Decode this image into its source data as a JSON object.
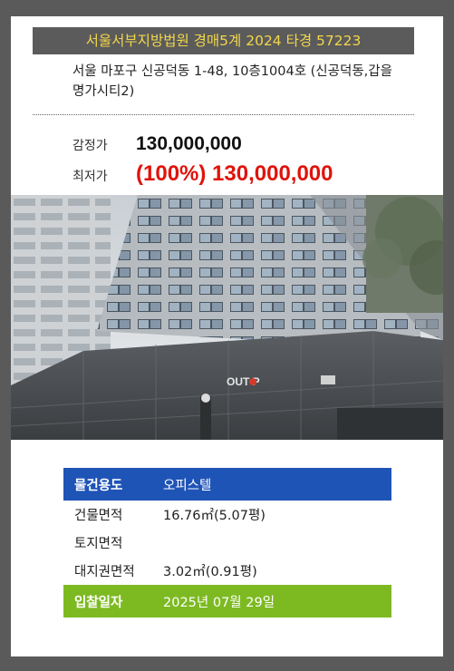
{
  "header": {
    "title": "서울서부지방법원 경매5계 2024 타경 57223"
  },
  "address": "서울 마포구 신공덕동 1-48, 10층1004호 (신공덕동,갑을명가시티2)",
  "prices": {
    "appraisal_label": "감정가",
    "appraisal_value": "130,000,000",
    "minimum_label": "최저가",
    "minimum_value": "(100%) 130,000,000"
  },
  "photo": {
    "sign_text": "OUT  P"
  },
  "details": [
    {
      "label": "물건용도",
      "value": "오피스텔"
    },
    {
      "label": "건물면적",
      "value": "16.76㎡(5.07평)"
    },
    {
      "label": "토지면적",
      "value": ""
    },
    {
      "label": "대지권면적",
      "value": "3.02㎡(0.91평)"
    },
    {
      "label": "입찰일자",
      "value": "2025년 07월 29일"
    }
  ],
  "colors": {
    "background": "#5a5a5a",
    "header_text": "#f2d64a",
    "minimum_price": "#e0130b",
    "usage_row": "#1f54b7",
    "bid_date_row": "#7dba22"
  }
}
